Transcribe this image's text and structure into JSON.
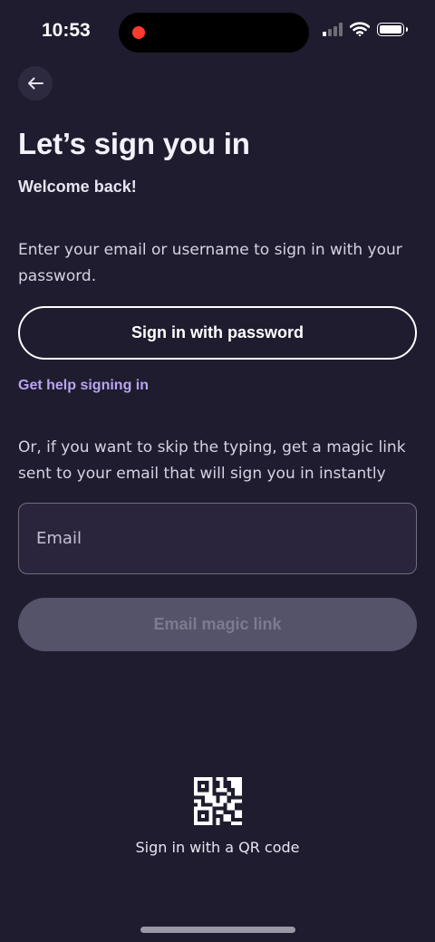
{
  "status_bar": {
    "time": "10:53"
  },
  "header": {
    "title": "Let’s sign you in",
    "subtitle": "Welcome back!"
  },
  "password_section": {
    "instruction": "Enter your email or username to sign in with your password.",
    "button_label": "Sign in with password",
    "help_link": "Get help signing in"
  },
  "magic_link_section": {
    "instruction": "Or, if you want to skip the typing, get a magic link sent to your email that will sign you in instantly",
    "email_placeholder": "Email",
    "email_value": "",
    "button_label": "Email magic link"
  },
  "qr": {
    "label": "Sign in with a QR code",
    "icon": "qr-code-icon"
  },
  "colors": {
    "background": "#1e1c2e",
    "link": "#b9a4f2",
    "disabled_button": "#55536a",
    "field_background": "#2a253d"
  }
}
